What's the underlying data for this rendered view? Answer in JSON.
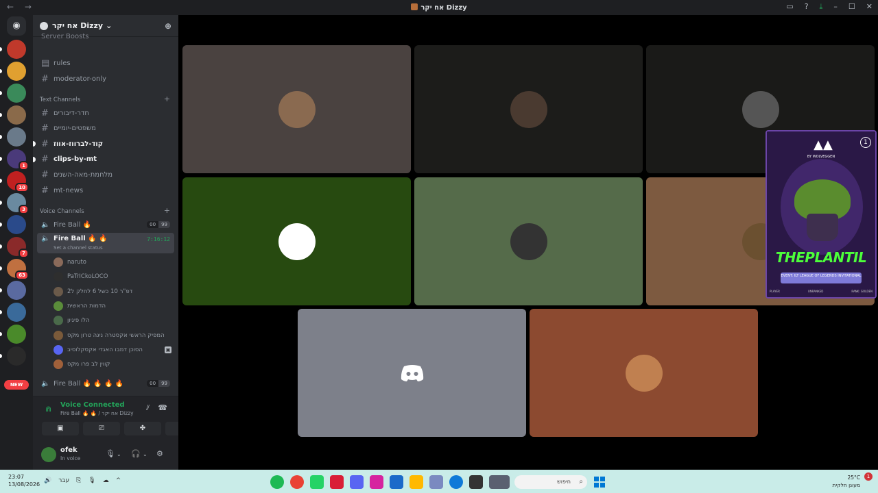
{
  "window": {
    "title": "אח יקר Dizzy",
    "nav_label": "← →"
  },
  "server": {
    "name": "אח יקר Dizzy",
    "boosts_label": "Server Boosts",
    "channels": [
      {
        "name": "rules",
        "unread": false
      },
      {
        "name": "moderator-only",
        "unread": false
      }
    ],
    "text_category": "Text Channels",
    "text_channels": [
      {
        "name": "חדר-דיבורים",
        "unread": false
      },
      {
        "name": "משפטים-יומיים",
        "unread": false
      },
      {
        "name": "קוד-לברווז-אווז",
        "unread": true
      },
      {
        "name": "clips-by-mt",
        "unread": true
      },
      {
        "name": "מלחמת-מאה-השנים",
        "unread": false
      },
      {
        "name": "mt-news",
        "unread": false
      }
    ],
    "voice_category": "Voice Channels",
    "voice_channels": [
      {
        "name": "Fire Ball 🔥",
        "count": "00",
        "limit": "99"
      },
      {
        "name": "Fire Ball 🔥 🔥",
        "timer": "7:16:12",
        "status": "Set a channel status"
      },
      {
        "name": "Fire Ball 🔥 🔥 🔥 🔥",
        "count": "00",
        "limit": "99"
      }
    ],
    "members": [
      {
        "name": "naruto",
        "color": "#8a6a5a"
      },
      {
        "name": "PaTrICkoLOCO",
        "color": "#2e2e2e"
      },
      {
        "name": "דפ\"ר 10 כשל 6 לחלק ל2",
        "color": "#6b5a4a"
      },
      {
        "name": "הדמות הראשית",
        "color": "#5a8c3a"
      },
      {
        "name": "הלו פיגיון",
        "color": "#4a6a4a"
      },
      {
        "name": "המפיק הראשי אקסטרה ניגה טרון מקס",
        "color": "#7a5a3a"
      },
      {
        "name": "הסוכן דמבו האגדי אקסקלוסיב",
        "color": "#5865f2"
      },
      {
        "name": "קווין לב פרו מקס",
        "color": "#a0603a"
      }
    ]
  },
  "voice_panel": {
    "title": "Voice Connected",
    "subtitle": "Fire Ball 🔥 🔥 / אח יקר Dizzy"
  },
  "user": {
    "name": "ofek",
    "status": "In voice"
  },
  "tiles": [
    {
      "bg": "#4a4240",
      "avatar": "#8a6a50"
    },
    {
      "bg": "#1c1c1a",
      "avatar": "#4a3a30"
    },
    {
      "bg": "#1a1a18",
      "avatar": "#555555"
    },
    {
      "bg": "#274a10",
      "avatar": "#ffffff"
    },
    {
      "bg": "#556b4a",
      "avatar": "#333333"
    },
    {
      "bg": "#7d5a40",
      "avatar": "#6b5030"
    },
    {
      "bg": "#7d808a",
      "avatar": "none"
    },
    {
      "bg": "#8c4a30",
      "avatar": "#c08050"
    }
  ],
  "overlay": {
    "brand": "BY WOLVEGGEN",
    "title": "THEPLANTIL",
    "subtitle": "EVENT: ILT LEAGUE OF LEGENDS INVITATIONAL",
    "badge": "1",
    "footer": [
      "PLAYER",
      "UNRANKED",
      "RANK: GOLDEN"
    ]
  },
  "taskbar": {
    "time": "23:07",
    "date": "13/08/2026",
    "lang": "עבר",
    "search_placeholder": "חיפוש",
    "weather_temp": "25°C",
    "weather_desc": "מעונן חלקית",
    "notif_count": "1"
  },
  "servers": [
    {
      "color": "#c0392b",
      "badge": ""
    },
    {
      "color": "#e0a030",
      "badge": ""
    },
    {
      "color": "#3a8a5a",
      "badge": ""
    },
    {
      "color": "#8a6a4a",
      "badge": ""
    },
    {
      "color": "#6a7a8a",
      "badge": ""
    },
    {
      "color": "#4a3a7a",
      "badge": "1"
    },
    {
      "color": "#c02020",
      "badge": "10"
    },
    {
      "color": "#6a8aa0",
      "badge": "3"
    },
    {
      "color": "#2a4a8a",
      "badge": ""
    },
    {
      "color": "#8a2a2a",
      "badge": "7"
    },
    {
      "color": "#c07040",
      "badge": "63"
    },
    {
      "color": "#5a6aa0",
      "badge": ""
    },
    {
      "color": "#3a6a9a",
      "badge": ""
    },
    {
      "color": "#4a8a2a",
      "badge": ""
    },
    {
      "color": "#2a2a2a",
      "badge": ""
    }
  ]
}
